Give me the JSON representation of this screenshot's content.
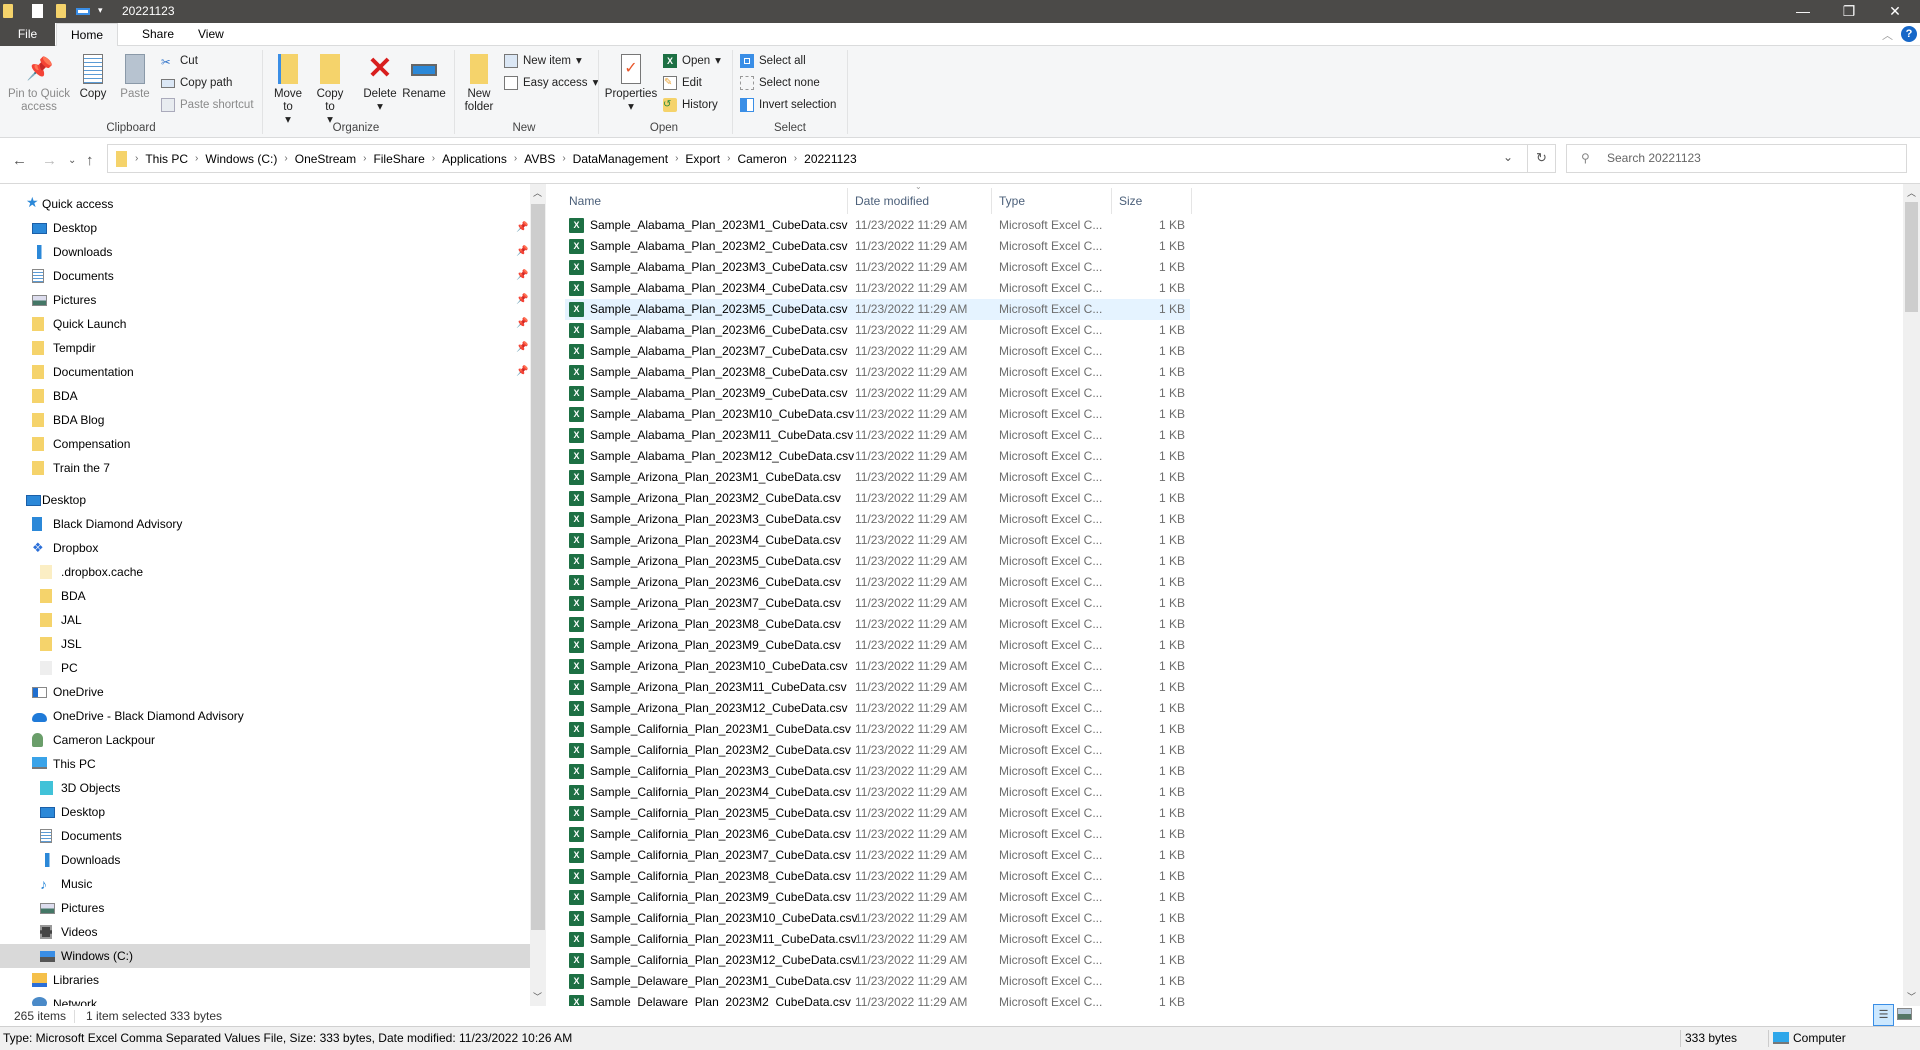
{
  "window": {
    "title": "20221123",
    "minimize": "—",
    "restore": "❐",
    "close": "✕"
  },
  "tabs": [
    "File",
    "Home",
    "Share",
    "View"
  ],
  "ribbon": {
    "clipboard": {
      "pin": "Pin to Quick access",
      "copy": "Copy",
      "paste": "Paste",
      "cut": "Cut",
      "copy_path": "Copy path",
      "paste_shortcut": "Paste shortcut",
      "label": "Clipboard"
    },
    "organize": {
      "move_to": "Move to",
      "copy_to": "Copy to",
      "delete": "Delete",
      "rename": "Rename",
      "label": "Organize"
    },
    "new": {
      "new_folder": "New folder",
      "new_item": "New item",
      "easy_access": "Easy access",
      "label": "New"
    },
    "open": {
      "properties": "Properties",
      "open": "Open",
      "edit": "Edit",
      "history": "History",
      "label": "Open"
    },
    "select": {
      "select_all": "Select all",
      "select_none": "Select none",
      "invert": "Invert selection",
      "label": "Select"
    }
  },
  "address": {
    "crumbs": [
      "This PC",
      "Windows (C:)",
      "OneStream",
      "FileShare",
      "Applications",
      "AVBS",
      "DataManagement",
      "Export",
      "Cameron",
      "20221123"
    ],
    "search_placeholder": "Search 20221123"
  },
  "nav": [
    {
      "label": "Quick access",
      "level": 0,
      "icon": "star"
    },
    {
      "label": "Desktop",
      "level": 1,
      "icon": "desktop",
      "pinned": true
    },
    {
      "label": "Downloads",
      "level": 1,
      "icon": "download",
      "pinned": true
    },
    {
      "label": "Documents",
      "level": 1,
      "icon": "documents",
      "pinned": true
    },
    {
      "label": "Pictures",
      "level": 1,
      "icon": "pictures",
      "pinned": true
    },
    {
      "label": "Quick Launch",
      "level": 1,
      "icon": "folder",
      "pinned": true
    },
    {
      "label": "Tempdir",
      "level": 1,
      "icon": "folder",
      "pinned": true
    },
    {
      "label": "Documentation",
      "level": 1,
      "icon": "folder",
      "pinned": true
    },
    {
      "label": "BDA",
      "level": 1,
      "icon": "folder"
    },
    {
      "label": "BDA Blog",
      "level": 1,
      "icon": "folder"
    },
    {
      "label": "Compensation",
      "level": 1,
      "icon": "folder"
    },
    {
      "label": "Train the 7",
      "level": 1,
      "icon": "folder"
    },
    {
      "label": "Desktop",
      "level": 0,
      "icon": "desktop",
      "gap": true
    },
    {
      "label": "Black Diamond Advisory",
      "level": 1,
      "icon": "building"
    },
    {
      "label": "Dropbox",
      "level": 1,
      "icon": "dropbox"
    },
    {
      "label": ".dropbox.cache",
      "level": 2,
      "icon": "folder-light"
    },
    {
      "label": "BDA",
      "level": 2,
      "icon": "folder"
    },
    {
      "label": "JAL",
      "level": 2,
      "icon": "folder"
    },
    {
      "label": "JSL",
      "level": 2,
      "icon": "folder"
    },
    {
      "label": "PC",
      "level": 2,
      "icon": "windows"
    },
    {
      "label": "OneDrive",
      "level": 1,
      "icon": "onedrive-window"
    },
    {
      "label": "OneDrive - Black Diamond Advisory",
      "level": 1,
      "icon": "cloud"
    },
    {
      "label": "Cameron Lackpour",
      "level": 1,
      "icon": "user"
    },
    {
      "label": "This PC",
      "level": 1,
      "icon": "pc"
    },
    {
      "label": "3D Objects",
      "level": 2,
      "icon": "cube"
    },
    {
      "label": "Desktop",
      "level": 2,
      "icon": "desktop"
    },
    {
      "label": "Documents",
      "level": 2,
      "icon": "documents"
    },
    {
      "label": "Downloads",
      "level": 2,
      "icon": "download"
    },
    {
      "label": "Music",
      "level": 2,
      "icon": "music"
    },
    {
      "label": "Pictures",
      "level": 2,
      "icon": "pictures"
    },
    {
      "label": "Videos",
      "level": 2,
      "icon": "videos"
    },
    {
      "label": "Windows (C:)",
      "level": 2,
      "icon": "drive",
      "selected": true
    },
    {
      "label": "Libraries",
      "level": 1,
      "icon": "libraries"
    },
    {
      "label": "Network",
      "level": 1,
      "icon": "network"
    }
  ],
  "columns": {
    "name": "Name",
    "date": "Date modified",
    "type": "Type",
    "size": "Size"
  },
  "files": [
    "Sample_Alabama_Plan_2023M1_CubeData.csv",
    "Sample_Alabama_Plan_2023M2_CubeData.csv",
    "Sample_Alabama_Plan_2023M3_CubeData.csv",
    "Sample_Alabama_Plan_2023M4_CubeData.csv",
    "Sample_Alabama_Plan_2023M5_CubeData.csv",
    "Sample_Alabama_Plan_2023M6_CubeData.csv",
    "Sample_Alabama_Plan_2023M7_CubeData.csv",
    "Sample_Alabama_Plan_2023M8_CubeData.csv",
    "Sample_Alabama_Plan_2023M9_CubeData.csv",
    "Sample_Alabama_Plan_2023M10_CubeData.csv",
    "Sample_Alabama_Plan_2023M11_CubeData.csv",
    "Sample_Alabama_Plan_2023M12_CubeData.csv",
    "Sample_Arizona_Plan_2023M1_CubeData.csv",
    "Sample_Arizona_Plan_2023M2_CubeData.csv",
    "Sample_Arizona_Plan_2023M3_CubeData.csv",
    "Sample_Arizona_Plan_2023M4_CubeData.csv",
    "Sample_Arizona_Plan_2023M5_CubeData.csv",
    "Sample_Arizona_Plan_2023M6_CubeData.csv",
    "Sample_Arizona_Plan_2023M7_CubeData.csv",
    "Sample_Arizona_Plan_2023M8_CubeData.csv",
    "Sample_Arizona_Plan_2023M9_CubeData.csv",
    "Sample_Arizona_Plan_2023M10_CubeData.csv",
    "Sample_Arizona_Plan_2023M11_CubeData.csv",
    "Sample_Arizona_Plan_2023M12_CubeData.csv",
    "Sample_California_Plan_2023M1_CubeData.csv",
    "Sample_California_Plan_2023M2_CubeData.csv",
    "Sample_California_Plan_2023M3_CubeData.csv",
    "Sample_California_Plan_2023M4_CubeData.csv",
    "Sample_California_Plan_2023M5_CubeData.csv",
    "Sample_California_Plan_2023M6_CubeData.csv",
    "Sample_California_Plan_2023M7_CubeData.csv",
    "Sample_California_Plan_2023M8_CubeData.csv",
    "Sample_California_Plan_2023M9_CubeData.csv",
    "Sample_California_Plan_2023M10_CubeData.csv",
    "Sample_California_Plan_2023M11_CubeData.csv",
    "Sample_California_Plan_2023M12_CubeData.csv",
    "Sample_Delaware_Plan_2023M1_CubeData.csv",
    "Sample_Delaware_Plan_2023M2_CubeData.csv"
  ],
  "file_common": {
    "date": "11/23/2022 11:29 AM",
    "type": "Microsoft Excel C...",
    "size": "1 KB"
  },
  "selected_file": "Sample_Alabama_Plan_2023M5_CubeData.csv",
  "status": {
    "count": "265 items",
    "selected": "1 item selected",
    "selected_size": "333 bytes"
  },
  "details_bar": {
    "text": "Type: Microsoft Excel Comma Separated Values File, Size: 333 bytes, Date modified: 11/23/2022 10:26 AM",
    "size": "333 bytes",
    "location": "Computer"
  },
  "colors": {
    "titlebar": "#4b4a48",
    "selection": "#e5f3ff",
    "nav_selection": "#d9d9d9",
    "excel": "#1d7044",
    "accent": "#0078d7"
  }
}
